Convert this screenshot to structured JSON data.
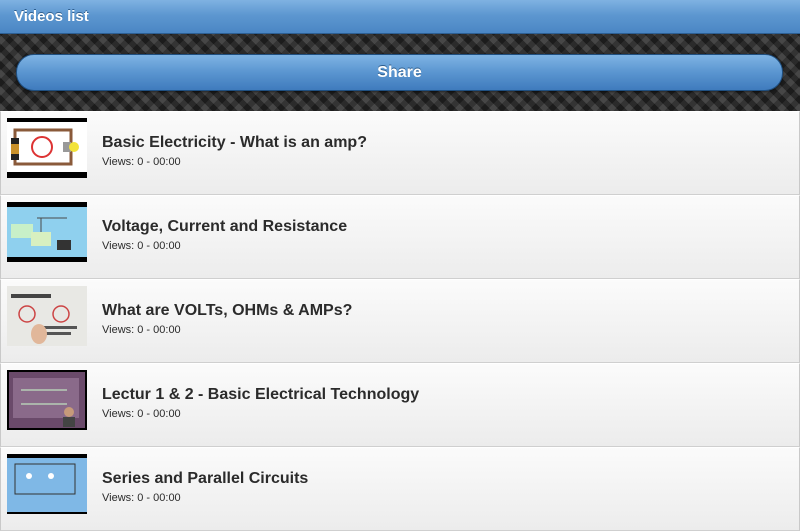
{
  "header": {
    "title": "Videos list"
  },
  "toolbar": {
    "share_label": "Share"
  },
  "videos": [
    {
      "title": "Basic Electricity - What is an amp?",
      "meta": "Views: 0 - 00:00",
      "thumb_icon": "circuit-diagram-thumbnail"
    },
    {
      "title": "Voltage, Current and Resistance",
      "meta": "Views: 0 - 00:00",
      "thumb_icon": "blue-slide-thumbnail"
    },
    {
      "title": "What are VOLTs, OHMs & AMPs?",
      "meta": "Views: 0 - 00:00",
      "thumb_icon": "whiteboard-thumbnail"
    },
    {
      "title": "Lectur 1 & 2 - Basic Electrical Technology",
      "meta": "Views: 0 - 00:00",
      "thumb_icon": "lecture-thumbnail"
    },
    {
      "title": "Series and Parallel Circuits",
      "meta": "Views: 0 - 00:00",
      "thumb_icon": "circuit-thumbnail"
    }
  ]
}
